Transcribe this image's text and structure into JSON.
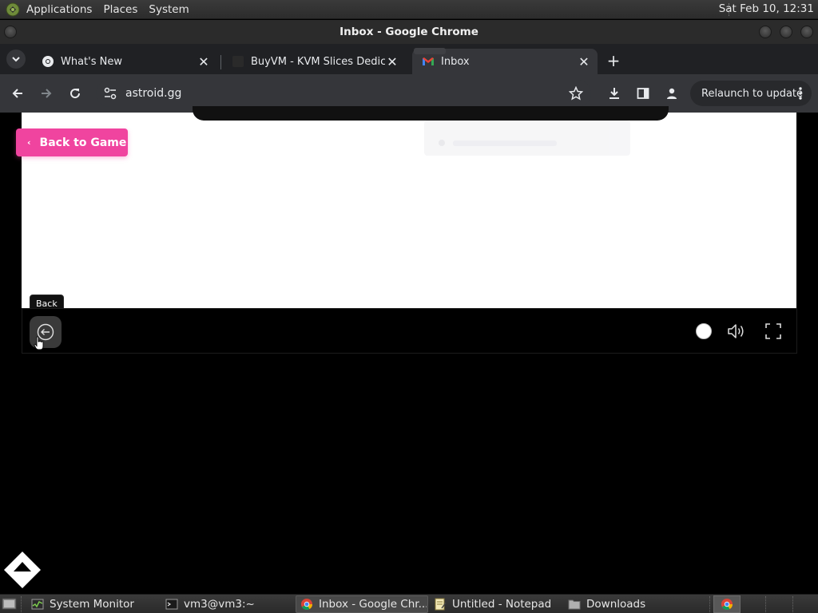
{
  "top_panel": {
    "menus": [
      "Applications",
      "Places",
      "System"
    ],
    "clock": "Sat Feb 10, 12:31"
  },
  "window": {
    "title": "Inbox - Google Chrome"
  },
  "tabs": [
    {
      "title": "What's New",
      "icon": "chrome-icon"
    },
    {
      "title": "BuyVM - KVM Slices Dedicated",
      "icon": "buyvm-icon"
    },
    {
      "title": "Inbox",
      "icon": "gmail-icon",
      "active": true
    }
  ],
  "toolbar": {
    "url": "astroid.gg",
    "relaunch_label": "Relaunch to update"
  },
  "page": {
    "back_to_game_label": "Back to Game",
    "back_tooltip": "Back",
    "accent_color": "#f0449f"
  },
  "taskbar": {
    "items": [
      {
        "label": "System Monitor",
        "icon": "system-monitor-icon"
      },
      {
        "label": "vm3@vm3:~",
        "icon": "terminal-icon"
      },
      {
        "label": "Inbox - Google Chr...",
        "icon": "chrome-icon",
        "active": true
      },
      {
        "label": "Untitled - Notepad",
        "icon": "notepad-icon"
      },
      {
        "label": "Downloads",
        "icon": "folder-icon"
      }
    ]
  }
}
